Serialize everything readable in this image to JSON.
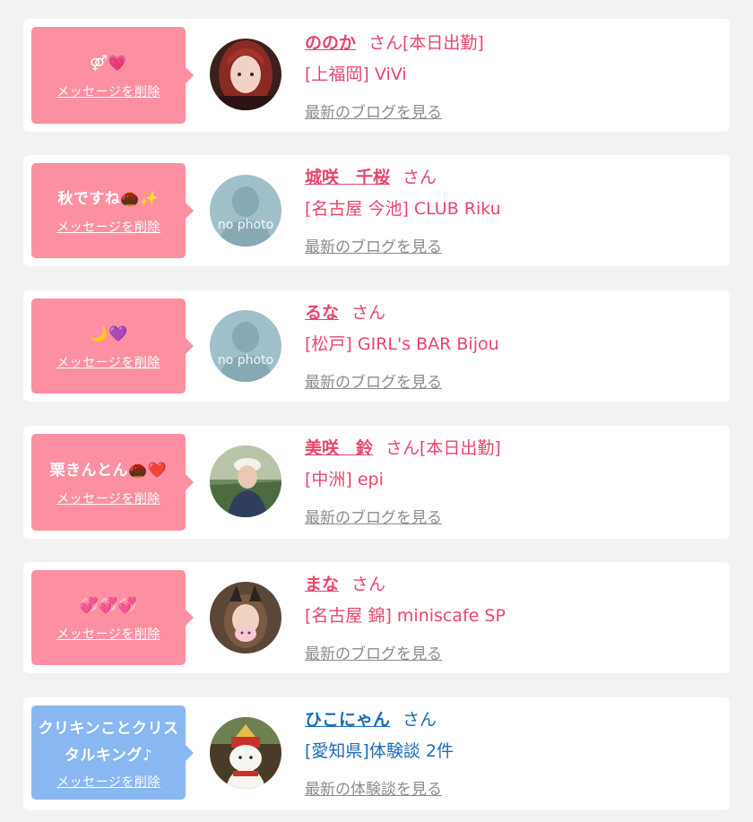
{
  "colors": {
    "bubble_pink": "#fd8fa2",
    "bubble_blue": "#89b7f1",
    "text_pink": "#e9456a",
    "text_blue": "#1c6bb5",
    "link_gray": "#8b8b8b",
    "background": "#f2f2f3"
  },
  "cards": [
    {
      "message": "⚤💗",
      "delete_label": "メッセージを削除",
      "name": "ののか",
      "suffix": "さん[本日出勤]",
      "shop": "[上福岡] ViVi",
      "link": "最新のブログを見る",
      "avatar": "photo-woman-red-hair"
    },
    {
      "message": "秋ですね🌰✨",
      "delete_label": "メッセージを削除",
      "name": "城咲　千桜",
      "suffix": "さん",
      "shop": "[名古屋 今池] CLUB Riku",
      "link": "最新のブログを見る",
      "avatar": "no photo"
    },
    {
      "message": "🌙💜",
      "delete_label": "メッセージを削除",
      "name": "るな",
      "suffix": "さん",
      "shop": "[松戸] GIRL's BAR Bijou",
      "link": "最新のブログを見る",
      "avatar": "no photo"
    },
    {
      "message": "栗きんとん🌰❤️",
      "delete_label": "メッセージを削除",
      "name": "美咲　鈴",
      "suffix": "さん[本日出勤]",
      "shop": "[中洲] epi",
      "link": "最新のブログを見る",
      "avatar": "photo-woman-white-cap"
    },
    {
      "message": "💞💞💞",
      "delete_label": "メッセージを削除",
      "name": "まな",
      "suffix": "さん",
      "shop": "[名古屋 錦] miniscafe SP",
      "link": "最新のブログを見る",
      "avatar": "photo-woman-cat-ears"
    },
    {
      "message": "クリキンことクリスタルキング♪",
      "delete_label": "メッセージを削除",
      "name": "ひこにゃん",
      "suffix": "さん",
      "shop": "[愛知県]体験談 2件",
      "link": "最新の体験談を見る",
      "avatar": "photo-hikonyan-mascot"
    }
  ]
}
